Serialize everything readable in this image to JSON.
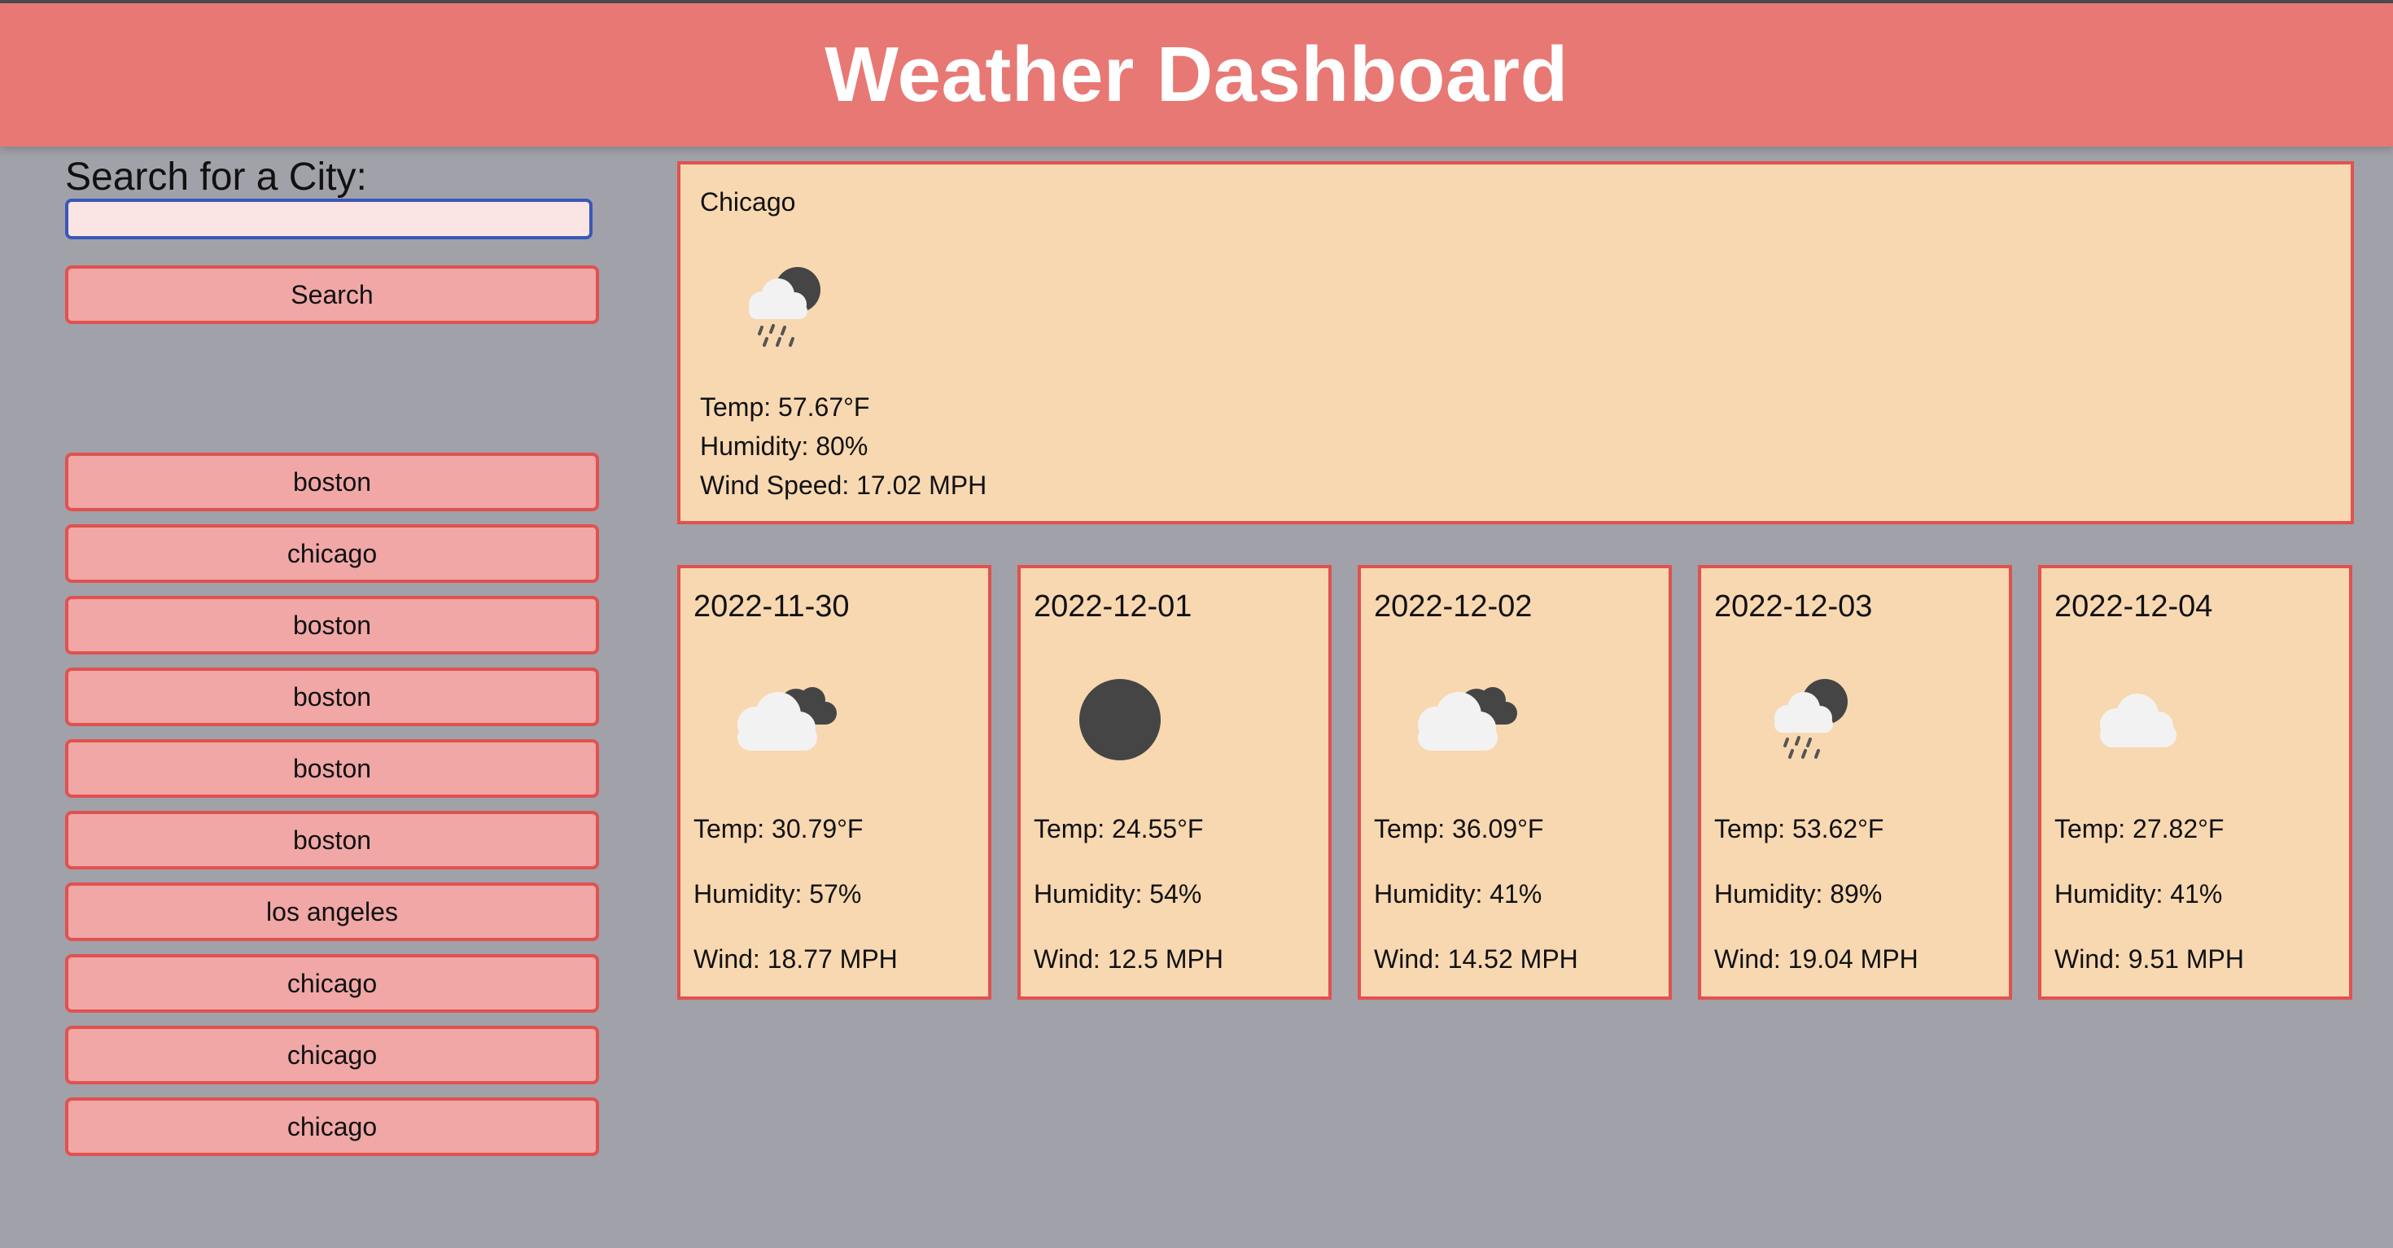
{
  "header": {
    "title": "Weather Dashboard"
  },
  "search": {
    "label": "Search for a City:",
    "value": "",
    "button_label": "Search"
  },
  "history": [
    "boston",
    "chicago",
    "boston",
    "boston",
    "boston",
    "boston",
    "los angeles",
    "chicago",
    "chicago",
    "chicago"
  ],
  "current": {
    "city": "Chicago",
    "icon": "rain-cloud-night-icon",
    "temp": "Temp: 57.67°F",
    "humidity": "Humidity: 80%",
    "wind": "Wind Speed: 17.02 MPH"
  },
  "forecast": [
    {
      "date": "2022-11-30",
      "icon": "broken-clouds-night-icon",
      "temp": "Temp: 30.79°F",
      "humidity": "Humidity: 57%",
      "wind": "Wind: 18.77 MPH"
    },
    {
      "date": "2022-12-01",
      "icon": "clear-night-icon",
      "temp": "Temp: 24.55°F",
      "humidity": "Humidity: 54%",
      "wind": "Wind: 12.5 MPH"
    },
    {
      "date": "2022-12-02",
      "icon": "broken-clouds-night-icon",
      "temp": "Temp: 36.09°F",
      "humidity": "Humidity: 41%",
      "wind": "Wind: 14.52 MPH"
    },
    {
      "date": "2022-12-03",
      "icon": "rain-cloud-night-icon",
      "temp": "Temp: 53.62°F",
      "humidity": "Humidity: 89%",
      "wind": "Wind: 19.04 MPH"
    },
    {
      "date": "2022-12-04",
      "icon": "cloud-icon",
      "temp": "Temp: 27.82°F",
      "humidity": "Humidity: 41%",
      "wind": "Wind: 9.51 MPH"
    }
  ],
  "colors": {
    "header": "#e87874",
    "background": "#a1a1aa",
    "card": "#f8d8b1",
    "border": "#e0524f",
    "button": "#f0a7a6"
  }
}
